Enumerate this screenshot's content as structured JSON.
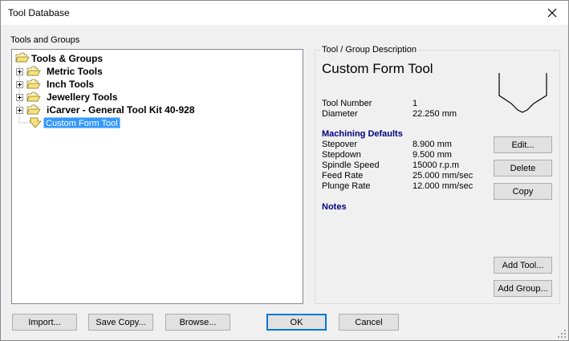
{
  "window": {
    "title": "Tool Database"
  },
  "tree": {
    "label": "Tools and Groups",
    "root": "Tools & Groups",
    "groups": [
      "Metric Tools",
      "Inch Tools",
      "Jewellery Tools",
      "iCarver - General Tool Kit 40-928"
    ],
    "selected_tool": "Custom Form Tool"
  },
  "description": {
    "group_label": "Tool / Group Description",
    "tool_name": "Custom Form Tool",
    "tool_number_label": "Tool Number",
    "tool_number_value": "1",
    "diameter_label": "Diameter",
    "diameter_value": "22.250 mm",
    "machining_defaults_heading": "Machining Defaults",
    "stepover_label": "Stepover",
    "stepover_value": "8.900 mm",
    "stepdown_label": "Stepdown",
    "stepdown_value": "9.500 mm",
    "spindle_label": "Spindle Speed",
    "spindle_value": "15000 r.p.m",
    "feed_label": "Feed Rate",
    "feed_value": "25.000 mm/sec",
    "plunge_label": "Plunge Rate",
    "plunge_value": "12.000 mm/sec",
    "notes_heading": "Notes"
  },
  "buttons": {
    "edit": "Edit...",
    "delete": "Delete",
    "copy": "Copy",
    "add_tool": "Add Tool...",
    "add_group": "Add Group...",
    "import": "Import...",
    "save_copy": "Save Copy...",
    "browse": "Browse...",
    "ok": "OK",
    "cancel": "Cancel"
  }
}
